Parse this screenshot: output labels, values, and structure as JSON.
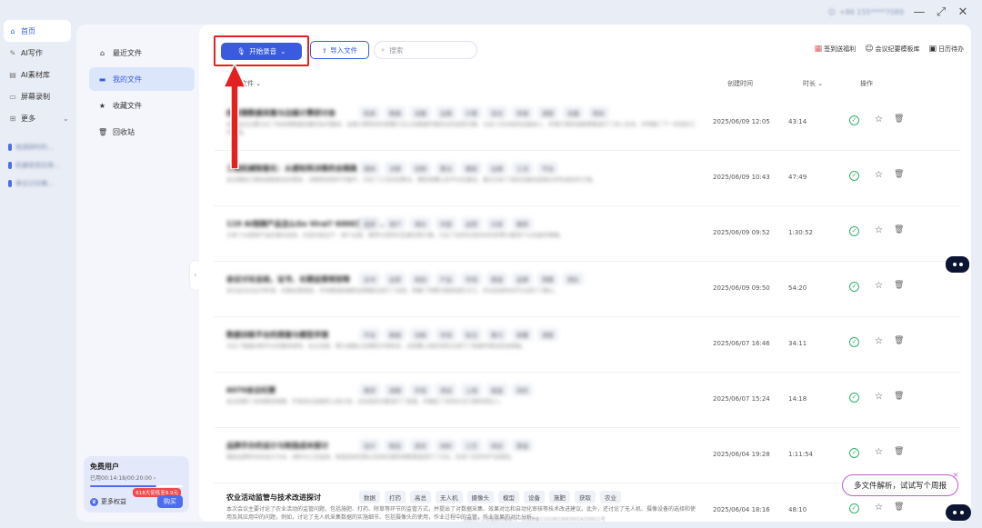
{
  "topbar": {
    "user_text": "+86 155****7089",
    "minimize": "—",
    "restore": "⤢",
    "close": "✕"
  },
  "leftnav": {
    "items": [
      {
        "label": "首页",
        "icon": "home-icon",
        "glyph": "⌂"
      },
      {
        "label": "AI写作",
        "icon": "write-icon",
        "glyph": "✎"
      },
      {
        "label": "AI素材库",
        "icon": "library-icon",
        "glyph": "▤"
      },
      {
        "label": "屏幕录制",
        "icon": "screen-record-icon",
        "glyph": "▭"
      },
      {
        "label": "更多",
        "icon": "more-icon",
        "glyph": "⊞",
        "chevron": "⌄"
      }
    ],
    "recent": [
      "他调研时的...",
      "机器视觉应用...",
      "审议讨论稿..."
    ]
  },
  "filenav": {
    "items": [
      {
        "label": "最近文件",
        "glyph": "⌂"
      },
      {
        "label": "我的文件",
        "glyph": "▬"
      },
      {
        "label": "收藏文件",
        "glyph": "★"
      },
      {
        "label": "回收站",
        "glyph": "🗑"
      }
    ]
  },
  "usercard": {
    "name": "免费用户",
    "usage": "已用00:14:18/00:20:00 ›",
    "usage_fraction": 0.72,
    "badge": "618大促低至9.9元",
    "benefit": "更多权益",
    "buy": "购买"
  },
  "toolbar": {
    "record_label": "开始录音",
    "record_chevron": "⌄",
    "import_label": "导入文件",
    "search_placeholder": "搜索",
    "actions": [
      {
        "label": "签到送福利",
        "glyph": "▦"
      },
      {
        "label": "会议纪要模板库",
        "glyph": "☺"
      },
      {
        "label": "日历待办",
        "glyph": "▣"
      }
    ]
  },
  "table": {
    "headers": {
      "name": "全部文件 ⌄",
      "created": "创建时间",
      "duration": "时长 ⌄",
      "actions": "操作"
    },
    "rows": [
      {
        "title": "机床侧数据采集与边缘计算研讨会",
        "tags": [
          "机床",
          "数据",
          "采集",
          "边缘",
          "计算",
          "协议",
          "存储",
          "调度",
          "设备",
          "网关"
        ],
        "desc": "本次会议主要讨论了机床侧数据采集的技术路线、边缘计算网关的部署方式以及数据传输协议的选型问题，与会人员对现场设备接入、存储方案和调度策略进行了深入交流，并明确了下一阶段的工作安排。",
        "date": "2025/06/09 12:05",
        "duration": "43:14",
        "blurred": true
      },
      {
        "title": "工程机械智能化：从感知到决策的全链路",
        "tags": [
          "感知",
          "决策",
          "控制",
          "算法",
          "模型",
          "边缘",
          "工况",
          "平台"
        ],
        "desc": "会议围绕工程机械智能化的感知、决策和控制环节展开，讨论了工况识别算法、模型部署以及平台化建设，重点分析了现有设备改造难点并形成初步方案。",
        "date": "2025/06/09 10:43",
        "duration": "47:49",
        "blurred": true
      },
      {
        "title": "119 AI视频产品怎么Go Viral? 6000万用户...",
        "tags": [
          "视频",
          "用户",
          "增长",
          "内容",
          "运营",
          "分发",
          "推荐"
        ],
        "desc": "分享了AI视频产品的增长经验，包括内容生产、用户运营、推荐分发和社区建设等方面，讨论了如何在短时间内获得大量用户以及留存策略。",
        "date": "2025/06/09 09:52",
        "duration": "1:30:52",
        "blurred": true
      },
      {
        "title": "会议讨论总结，证书、长期运营规划等",
        "tags": [
          "证书",
          "运营",
          "规划",
          "产品",
          "市场",
          "渠道",
          "品牌",
          "预算",
          "团队"
        ],
        "desc": "本次会议对证书申请、长期运营规划、市场渠道拓展和品牌建设进行了总结，明确了预算分配和团队分工，并对后续时间节点进行了确认。",
        "date": "2025/06/09 09:50",
        "duration": "54:20",
        "blurred": true
      },
      {
        "title": "数据训练平台的搭建与模型评测",
        "tags": [
          "平台",
          "数据",
          "训练",
          "评测",
          "标注",
          "算力",
          "部署",
          "调度"
        ],
        "desc": "讨论了数据训练平台的整体架构、标注流程、算力调度以及模型评测体系，对部署上线的风险点进行了梳理并提出改进措施。",
        "date": "2025/06/07 16:46",
        "duration": "34:11",
        "blurred": true
      },
      {
        "title": "6070会议纪要",
        "tags": [
          "需求",
          "排期",
          "开发",
          "测试",
          "上线",
          "复盘",
          "风险"
        ],
        "desc": "会议回顾了本周需求排期、开发测试进度和上线计划，对出现的问题进行了复盘，并确定了风险应对方案和责任人。",
        "date": "2025/06/07 15:24",
        "duration": "14:18",
        "blurred": true
      },
      {
        "title": "品牌手办的设计与制造成本探讨",
        "tags": [
          "设计",
          "制造",
          "成本",
          "材料",
          "工艺",
          "供应",
          "渠道"
        ],
        "desc": "围绕品牌手办的设计方向、材料与工艺选择、制造成本控制以及供应链和销售渠道进行了讨论，形成了初步的产品规划。",
        "date": "2025/06/04 19:28",
        "duration": "1:11:54",
        "blurred": true
      },
      {
        "title": "农业活动监管与技术改进探讨",
        "tags": [
          "数据",
          "打药",
          "高总",
          "无人机",
          "摄像头",
          "模型",
          "设备",
          "施肥",
          "获取",
          "农业"
        ],
        "desc": "本次会议主要讨论了农业活动的监管问题，包括施肥、打药、除草等环节的监管方式，并提出了对数据采集、效果对比和自动化审核等技术改进建议。此外，还讨论了无人机、摄像设备的选择和使用及其应用中的问题，例如，讨论了无人机采集数据的实施细节、包括摄像头的使用，作业过程中的监管，作业效果的对比分析...",
        "date": "2025/06/04 18:16",
        "duration": "48:10",
        "blurred": false
      }
    ]
  },
  "footer_note": "生成式人工智能服务备案号 · 网信算备110108236830024230011号",
  "tip": {
    "text": "多文件解析，试试写个周报",
    "close": "×"
  },
  "colors": {
    "accent": "#3a5be0",
    "highlight_red": "#e32121",
    "success": "#2fb36b",
    "tip_border": "#c25bd0"
  }
}
